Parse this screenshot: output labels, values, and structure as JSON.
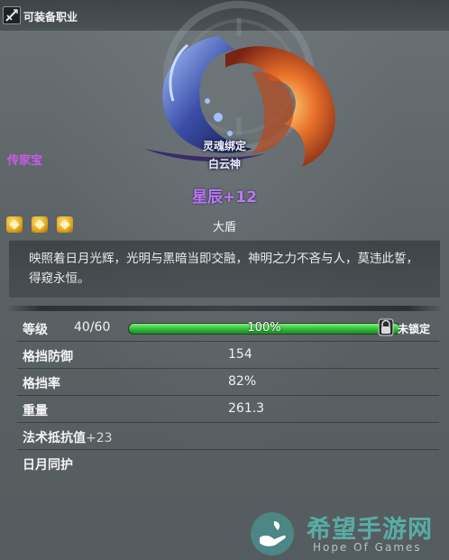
{
  "header": {
    "class_label": "可装备职业",
    "class_icon": "sword-class-icon"
  },
  "item": {
    "bind_status": "灵魂绑定",
    "god_name": "白云神",
    "rarity": "传家宝",
    "name": "星辰+12",
    "type": "大盾",
    "stars": 3,
    "description": "映照着日月光辉，光明与黑暗当即交融，神明之力不吝与人，莫违此誓，得窥永恒。"
  },
  "level": {
    "label": "等级",
    "value": "40/60",
    "progress_text": "100%",
    "progress": 1.0,
    "lock_icon": "lock-icon",
    "lock_label": "未锁定"
  },
  "stats": [
    {
      "label": "格挡防御",
      "value": "154"
    },
    {
      "label": "格挡率",
      "value": "82%"
    },
    {
      "label": "重量",
      "value": "261.3"
    }
  ],
  "extra": {
    "magic_resist_label": "法术抵抗值",
    "magic_resist_bonus": "+23",
    "skill_name": "日月同护"
  },
  "watermark": {
    "cn": "希望手游网",
    "en": "Hope Of Games"
  },
  "colors": {
    "rarity": "#c85ae8",
    "item_name": "#b97bf2",
    "progress_fill": "#2fbb35",
    "star": "#e0a51c"
  }
}
